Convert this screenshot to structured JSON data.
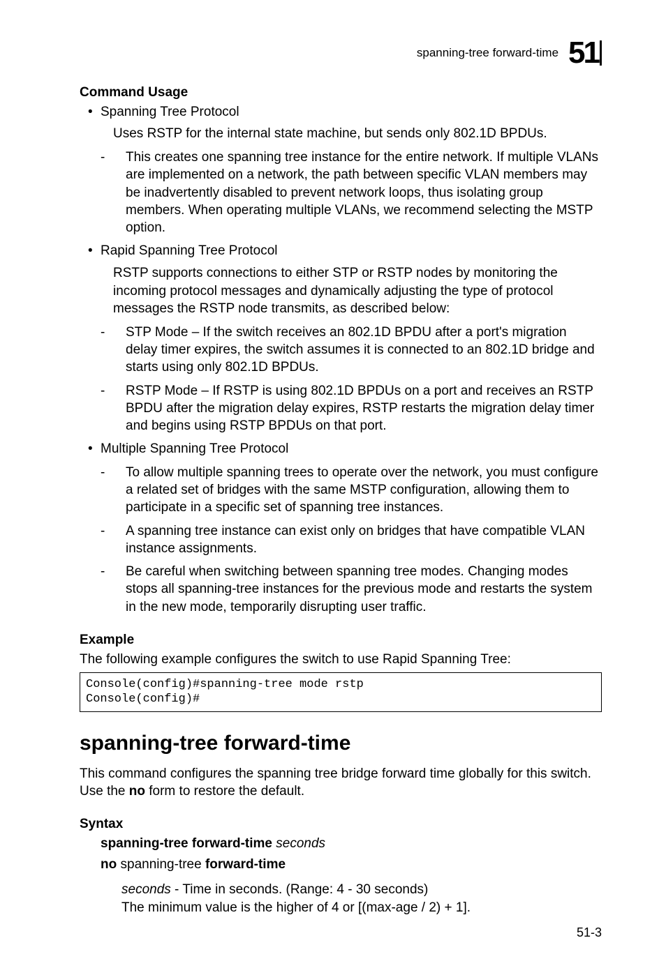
{
  "running_head": {
    "text": "spanning-tree forward-time",
    "chapter": "51"
  },
  "command_usage": {
    "heading": "Command Usage",
    "items": [
      {
        "label": "Spanning Tree Protocol",
        "desc": "Uses RSTP for the internal state machine, but sends only 802.1D BPDUs.",
        "sub": [
          "This creates one spanning tree instance for the entire network. If multiple VLANs are implemented on a network, the path between specific VLAN members may be inadvertently disabled to prevent network loops, thus isolating group members. When operating multiple VLANs, we recommend selecting the MSTP option."
        ]
      },
      {
        "label": "Rapid Spanning Tree Protocol",
        "desc": "RSTP supports connections to either STP or RSTP nodes by monitoring the incoming protocol messages and dynamically adjusting the type of protocol messages the RSTP node transmits, as described below:",
        "sub": [
          "STP Mode – If the switch receives an 802.1D BPDU after a port's migration delay timer expires, the switch assumes it is connected to an 802.1D bridge and starts using only 802.1D BPDUs.",
          "RSTP Mode – If RSTP is using 802.1D BPDUs on a port and receives an RSTP BPDU after the migration delay expires, RSTP restarts the migration delay timer and begins using RSTP BPDUs on that port."
        ]
      },
      {
        "label": "Multiple Spanning Tree Protocol",
        "desc": "",
        "sub": [
          "To allow multiple spanning trees to operate over the network, you must configure a related set of bridges with the same MSTP configuration, allowing them to participate in a specific set of spanning tree instances.",
          "A spanning tree instance can exist only on bridges that have compatible VLAN instance assignments.",
          "Be careful when switching between spanning tree modes. Changing modes stops all spanning-tree instances for the previous mode and restarts the system in the new mode, temporarily disrupting user traffic."
        ]
      }
    ]
  },
  "example": {
    "heading": "Example",
    "lead": "The following example configures the switch to use Rapid Spanning Tree:",
    "code": "Console(config)#spanning-tree mode rstp\nConsole(config)#"
  },
  "section": {
    "title": "spanning-tree forward-time",
    "intro_pre": "This command configures the spanning tree bridge forward time globally for this switch. Use the ",
    "intro_bold": "no",
    "intro_post": " form to restore the default."
  },
  "syntax": {
    "heading": "Syntax",
    "line1_bold": "spanning-tree forward-time",
    "line1_italic": "seconds",
    "line2_bold1": "no",
    "line2_plain": " spanning-tree ",
    "line2_bold2": "forward-time",
    "param_name": "seconds",
    "param_desc": " - Time in seconds. (Range: 4 - 30 seconds)",
    "param_line2": "The minimum value is the higher of 4 or [(max-age / 2) + 1]."
  },
  "footer": {
    "page": "51-3"
  }
}
